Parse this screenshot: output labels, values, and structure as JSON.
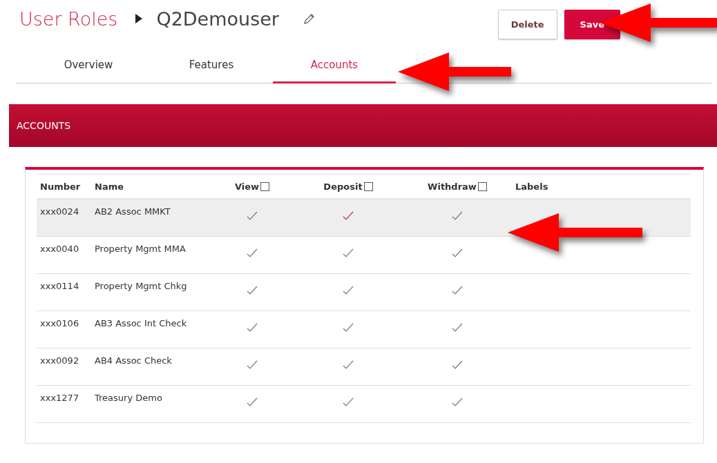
{
  "header": {
    "breadcrumb": "User Roles",
    "title": "Q2Demouser"
  },
  "buttons": [
    {
      "label": "Delete",
      "kind": "secondary"
    },
    {
      "label": "Save",
      "kind": "primary"
    }
  ],
  "tabs": [
    {
      "label": "Overview",
      "selected": false
    },
    {
      "label": "Features",
      "selected": false
    },
    {
      "label": "Accounts",
      "selected": true
    }
  ],
  "section": {
    "title": "ACCOUNTS"
  },
  "table": {
    "columns": [
      {
        "label": "Number",
        "kind": "text"
      },
      {
        "label": "Name",
        "kind": "text"
      },
      {
        "label": "View",
        "kind": "check",
        "checked": false
      },
      {
        "label": "Deposit",
        "kind": "check",
        "checked": false
      },
      {
        "label": "Withdraw",
        "kind": "check",
        "checked": false
      },
      {
        "label": "Labels",
        "kind": "text"
      }
    ],
    "rows": [
      {
        "number": "xxx0024",
        "name": "AB2 Assoc MMKT",
        "selected": true,
        "view": {
          "checked": true,
          "hovered": false
        },
        "deposit": {
          "checked": true,
          "hovered": true
        },
        "withdraw": {
          "checked": true,
          "hovered": false
        }
      },
      {
        "number": "xxx0040",
        "name": "Property Mgmt MMA",
        "selected": false,
        "view": {
          "checked": true,
          "hovered": false
        },
        "deposit": {
          "checked": true,
          "hovered": false
        },
        "withdraw": {
          "checked": true,
          "hovered": false
        }
      },
      {
        "number": "xxx0114",
        "name": "Property Mgmt Chkg",
        "selected": false,
        "view": {
          "checked": true,
          "hovered": false
        },
        "deposit": {
          "checked": true,
          "hovered": false
        },
        "withdraw": {
          "checked": true,
          "hovered": false
        }
      },
      {
        "number": "xxx0106",
        "name": "AB3 Assoc Int Check",
        "selected": false,
        "view": {
          "checked": true,
          "hovered": false
        },
        "deposit": {
          "checked": true,
          "hovered": false
        },
        "withdraw": {
          "checked": true,
          "hovered": false
        }
      },
      {
        "number": "xxx0092",
        "name": "AB4 Assoc Check",
        "selected": false,
        "view": {
          "checked": true,
          "hovered": false
        },
        "deposit": {
          "checked": true,
          "hovered": false
        },
        "withdraw": {
          "checked": true,
          "hovered": false
        }
      },
      {
        "number": "xxx1277",
        "name": "Treasury Demo",
        "selected": false,
        "view": {
          "checked": true,
          "hovered": false
        },
        "deposit": {
          "checked": true,
          "hovered": false
        },
        "withdraw": {
          "checked": true,
          "hovered": false
        }
      }
    ]
  }
}
